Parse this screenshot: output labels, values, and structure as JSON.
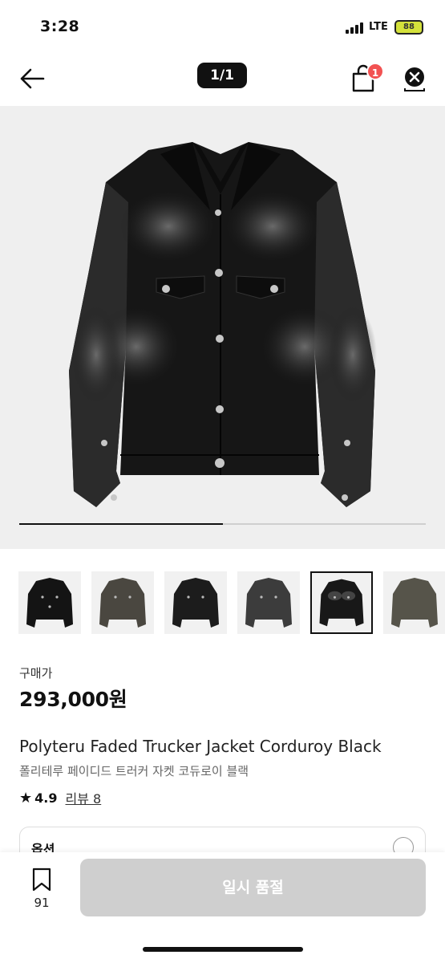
{
  "status_bar": {
    "time": "3:28",
    "network": "LTE",
    "battery": "88"
  },
  "nav": {
    "counter": "1/1",
    "cart_badge": "1"
  },
  "gallery": {
    "progress": 0.5,
    "thumbnail_count": 6,
    "selected_index": 4
  },
  "product": {
    "price_label": "구매가",
    "price": "293,000원",
    "name_en": "Polyteru Faded Trucker Jacket Corduroy Black",
    "name_ko": "폴리테루 페이디드 트러커 자켓 코듀로이 블랙",
    "rating": "4.9",
    "review_label": "리뷰 8"
  },
  "options": {
    "label": "옵션"
  },
  "bottom": {
    "bookmark_count": "91",
    "buy_label": "일시 품절"
  },
  "colors": {
    "accent_badge": "#f25252",
    "disabled_button": "#cfcfcf",
    "hero_background": "#efefef"
  }
}
